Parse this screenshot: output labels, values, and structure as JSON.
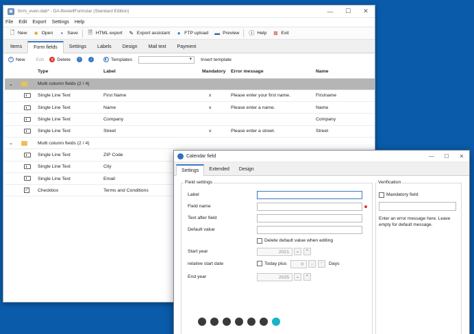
{
  "main_window": {
    "title": "form_even.dab* - DA-BestellFormular (Standard Edition)",
    "menu": [
      "File",
      "Edit",
      "Export",
      "Settings",
      "Help"
    ],
    "toolbar": {
      "new": "New",
      "open": "Open",
      "save": "Save",
      "html_export": "HTML export",
      "export_assistant": "Export assistant",
      "ftp_upload": "FTP upload",
      "preview": "Preview",
      "help": "Help",
      "exit": "Exit"
    },
    "tabs": [
      "Items",
      "Form fields",
      "Settings",
      "Labels",
      "Design",
      "Mail text",
      "Payment"
    ],
    "active_tab": "Form fields",
    "subbar": {
      "new": "New",
      "edit": "Edit",
      "delete": "Delete",
      "templates": "Templates",
      "insert_template": "Insert template"
    },
    "columns": {
      "type": "Type",
      "label": "Label",
      "mandatory": "Mandatory",
      "error": "Error message",
      "name": "Name"
    },
    "rows": [
      {
        "kind": "group",
        "type": "Multi column fields (2 / 4)",
        "highlight": true
      },
      {
        "kind": "field",
        "icon": "textfield",
        "type": "Single Line Text",
        "label": "First Name",
        "mandatory": "x",
        "error": "Please enter your first name.",
        "name": "Firstname"
      },
      {
        "kind": "field",
        "icon": "textfield",
        "type": "Single Line Text",
        "label": "Name",
        "mandatory": "x",
        "error": "Please enter a name.",
        "name": "Name"
      },
      {
        "kind": "field",
        "icon": "textfield",
        "type": "Single Line Text",
        "label": "Company",
        "mandatory": "",
        "error": "",
        "name": "Company"
      },
      {
        "kind": "field",
        "icon": "textfield",
        "type": "Single Line Text",
        "label": "Street",
        "mandatory": "x",
        "error": "Please enter a street.",
        "name": "Street"
      },
      {
        "kind": "group",
        "type": "Multi column fields (2 / 4)",
        "highlight": false
      },
      {
        "kind": "field",
        "icon": "textfield",
        "type": "Single Line Text",
        "label": "ZIP Code",
        "mandatory": "",
        "error": "",
        "name": ""
      },
      {
        "kind": "field",
        "icon": "textfield",
        "type": "Single Line Text",
        "label": "City",
        "mandatory": "",
        "error": "",
        "name": ""
      },
      {
        "kind": "field",
        "icon": "textfield",
        "type": "Single Line Text",
        "label": "Email",
        "mandatory": "",
        "error": "",
        "name": ""
      },
      {
        "kind": "field",
        "icon": "checkbox",
        "type": "Checkbox",
        "label": "Terms and Conditions",
        "mandatory": "",
        "error": "",
        "name": ""
      }
    ]
  },
  "dialog": {
    "title": "Calendar field",
    "tabs": [
      "Settings",
      "Extended",
      "Design"
    ],
    "active_tab": "Settings",
    "field_settings_title": "Field settings",
    "labels": {
      "label": "Label",
      "field_name": "Field name",
      "text_after_field": "Text after field",
      "default_value": "Default value",
      "delete_default": "Delete default value when editing",
      "start_year": "Start year",
      "relative_start_date": "relative start date",
      "today_plus": "Today plus",
      "days": "Days",
      "end_year": "End year"
    },
    "start_year_value": "2021",
    "today_plus_value": "0",
    "end_year_value": "2025",
    "verification": {
      "title": "Verification",
      "mandatory_field": "Mandatory field",
      "note": "Enter an error message here. Leave empty for default message."
    }
  },
  "carousel": {
    "count": 7,
    "active_index": 6
  }
}
